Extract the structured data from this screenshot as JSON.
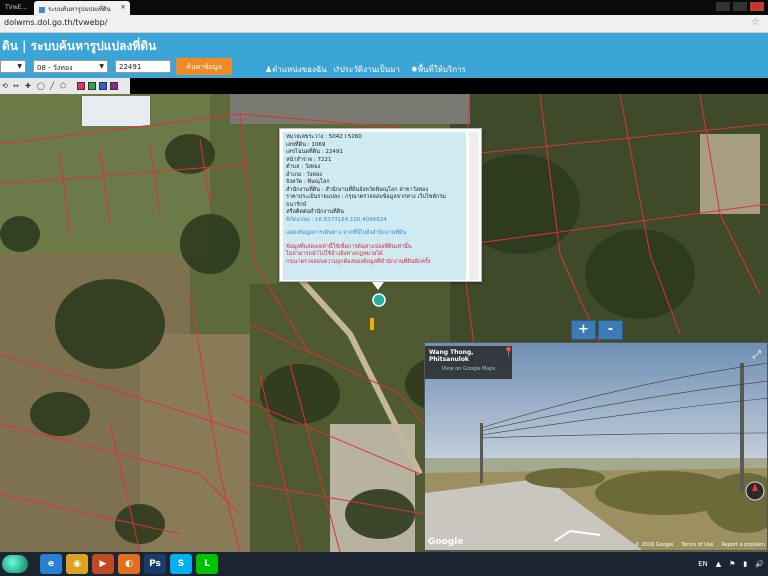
{
  "browser": {
    "tab1_label": "TVwE...",
    "tab2_label": "ระบบค้นหารูปแปลงที่ดิน",
    "tab2_close": "×",
    "url": "dolwms.dol.go.th/tvwebp/",
    "star": "☆"
  },
  "header": {
    "title": "ดิน | ระบบค้นหารูปแปลงที่ดิน",
    "province_value": "",
    "district_value": "08 - วังทอง",
    "parcel_value": "22491",
    "search_label": "ค้นหาข้อมูล",
    "nav": [
      "ตำแหน่งของฉัน",
      "ประวัติงานเป็นมา",
      "พื้นที่ให้บริการ"
    ]
  },
  "toolbar": {
    "tools": [
      "⟲",
      "↔",
      "✚",
      "◯"
    ],
    "colors": [
      "#e03070",
      "#2aa44a",
      "#3060d0",
      "#8a2a8a"
    ]
  },
  "popup": {
    "lines": [
      {
        "text": "หมายเลขระวาง : 5042 I 5260",
        "cls": ""
      },
      {
        "text": "เลขที่ดิน : 1069",
        "cls": ""
      },
      {
        "text": "เลขโฉนดที่ดิน : 22491",
        "cls": ""
      },
      {
        "text": "หน้าสำรวจ : 7221",
        "cls": ""
      },
      {
        "text": "ตำบล : วังทอง",
        "cls": ""
      },
      {
        "text": "อำเภอ : วังทอง",
        "cls": ""
      },
      {
        "text": "จังหวัด : พิษณุโลก",
        "cls": ""
      },
      {
        "text": "สำนักงานที่ดิน : สำนักงานที่ดินจังหวัดพิษณุโลก สาขาวังทอง",
        "cls": ""
      },
      {
        "text": "ราคาประเมินรายแปลง : กรุณาตรวจสอบข้อมูลจากทาง เว็บไซต์กรมธนารักษ์",
        "cls": ""
      },
      {
        "text": "หรือติดต่อสำนักงานที่ดิน",
        "cls": ""
      },
      {
        "text": "พิกัดแปลง : 16.8373184,100.4066624",
        "cls": "coord"
      },
      {
        "text": "",
        "cls": "sp"
      },
      {
        "text": "แสดงข้อมูลการเดินทาง จากที่นี่ไปยังสำนักงานที่ดิน",
        "cls": "route"
      },
      {
        "text": "",
        "cls": "sp"
      },
      {
        "text": "ข้อมูลที่แสดงเหล่านี้ใช้เพื่อการค้นหาแปลงที่ดินเท่านั้น",
        "cls": "red"
      },
      {
        "text": "ไม่สามารถนำไปใช้อ้างอิงทางกฎหมายได้",
        "cls": "red"
      },
      {
        "text": "กรุณาตรวจสอบความถูกต้องของข้อมูลที่สำนักงานที่ดินอีกครั้ง",
        "cls": "red"
      }
    ]
  },
  "zoom": {
    "in": "+",
    "out": "-"
  },
  "streetview": {
    "place": "Wang Thong, Phitsanulok",
    "link": "View on Google Maps",
    "pin": "📍",
    "expand": "⤢",
    "google": "Google",
    "copyright": "© 2016 Google",
    "terms": "Terms of Use",
    "report": "Report a problem"
  },
  "taskbar": {
    "apps": [
      {
        "name": "ie",
        "label": "e",
        "color": "#2a7fd4"
      },
      {
        "name": "chrome",
        "label": "◉",
        "color": "#e0a020"
      },
      {
        "name": "media",
        "label": "▶",
        "color": "#c04a20"
      },
      {
        "name": "firefox",
        "label": "◐",
        "color": "#e07020"
      },
      {
        "name": "photoshop",
        "label": "Ps",
        "color": "#1a3a6a"
      },
      {
        "name": "skype",
        "label": "S",
        "color": "#00aff0"
      },
      {
        "name": "line",
        "label": "L",
        "color": "#00c300"
      }
    ],
    "lang": "EN",
    "tray_icons": [
      "▲",
      "⚑",
      "▮",
      "🔊"
    ]
  }
}
